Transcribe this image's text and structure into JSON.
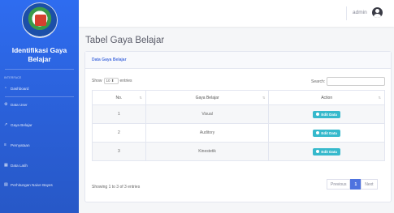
{
  "app": {
    "brand_title": "Identifikasi Gaya Belajar"
  },
  "sidebar": {
    "heading": "INTERFACE",
    "items": [
      {
        "icon": "dashboard-icon",
        "label": "Dashboard"
      },
      {
        "icon": "user-icon",
        "label": "Data User"
      },
      {
        "icon": "wrench-icon",
        "label": "Gaya Belajar"
      },
      {
        "icon": "list-icon",
        "label": "Pernyataan"
      },
      {
        "icon": "table-icon",
        "label": "Data Latih"
      },
      {
        "icon": "document-icon",
        "label": "Perhitungan Naive Bayes"
      }
    ]
  },
  "topbar": {
    "user_name": "admin"
  },
  "page": {
    "title": "Tabel Gaya Belajar"
  },
  "card": {
    "header": "Data Gaya Belajar",
    "show_label": "Show",
    "entries_value": "10",
    "entries_label": "entries",
    "search_label": "Search:",
    "search_value": "",
    "columns": [
      "No.",
      "Gaya Belajar",
      "Action"
    ],
    "rows": [
      {
        "no": "1",
        "gaya": "Visual",
        "action": "Edit Data"
      },
      {
        "no": "2",
        "gaya": "Auditory",
        "action": "Edit Data"
      },
      {
        "no": "3",
        "gaya": "Kinestetik",
        "action": "Edit Data"
      }
    ],
    "info": "Showing 1 to 3 of 3 entries",
    "pagination": {
      "previous": "Previous",
      "current": "1",
      "next": "Next"
    }
  },
  "colors": {
    "sidebar": "#2e6cf0",
    "primary": "#4e73df",
    "info_button": "#36b9cc"
  }
}
